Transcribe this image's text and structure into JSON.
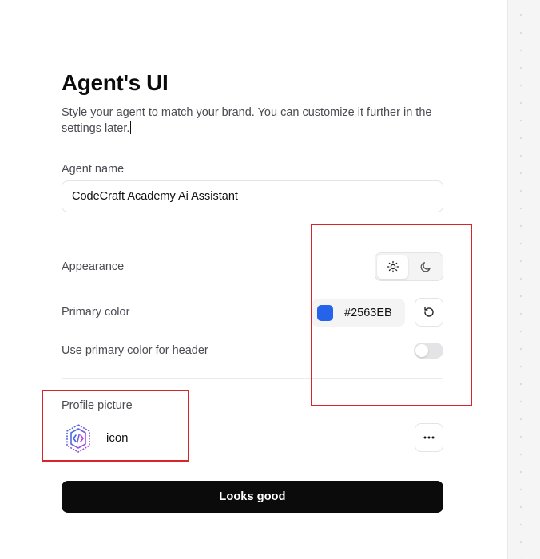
{
  "header": {
    "title": "Agent's UI",
    "subtitle": "Style your agent to match your brand. You can customize it further in the settings later."
  },
  "agent_name": {
    "label": "Agent name",
    "value": "CodeCraft Academy Ai Assistant"
  },
  "appearance": {
    "label": "Appearance",
    "selected": "light",
    "options": [
      "sun-icon",
      "moon-icon"
    ]
  },
  "primary_color": {
    "label": "Primary color",
    "value": "#2563EB",
    "swatch_color": "#2563EB",
    "reset_icon": "reset-icon"
  },
  "header_color": {
    "label": "Use primary color for header",
    "enabled": false
  },
  "profile": {
    "label": "Profile picture",
    "name": "icon",
    "menu_icon": "more-horizontal-icon"
  },
  "actions": {
    "submit_label": "Looks good"
  },
  "colors": {
    "annotation": "#d6262b",
    "button_bg": "#0b0b0c"
  }
}
